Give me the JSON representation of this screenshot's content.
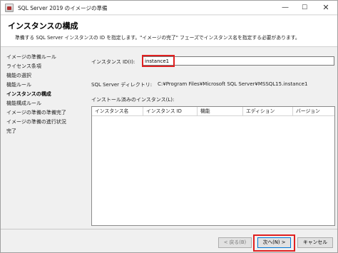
{
  "window": {
    "title": "SQL Server 2019 のイメージの準備",
    "minimize": "—",
    "maximize": "☐",
    "close": "✕"
  },
  "header": {
    "title": "インスタンスの構成",
    "description": "準備する SQL Server インスタンスの ID を指定します。\"イメージの完了\" フェーズでインスタンス名を指定する必要があります。"
  },
  "sidebar": {
    "items": [
      {
        "label": "イメージの準備ルール",
        "active": false
      },
      {
        "label": "ライセンス条項",
        "active": false
      },
      {
        "label": "機能の選択",
        "active": false
      },
      {
        "label": "機能ルール",
        "active": false
      },
      {
        "label": "インスタンスの構成",
        "active": true
      },
      {
        "label": "機能構成ルール",
        "active": false
      },
      {
        "label": "イメージの準備の準備完了",
        "active": false
      },
      {
        "label": "イメージの準備の進行状況",
        "active": false
      },
      {
        "label": "完了",
        "active": false
      }
    ]
  },
  "main": {
    "instance_id_label": "インスタンス ID(I):",
    "instance_id_value": "instance1",
    "directory_label": "SQL Server ディレクトリ:",
    "directory_value": "C:¥Program Files¥Microsoft SQL Server¥MSSQL15.instance1",
    "installed_label": "インストール済みのインスタンス(L):",
    "columns": [
      "インスタンス名",
      "インスタンス ID",
      "機能",
      "エディション",
      "バージョン"
    ]
  },
  "footer": {
    "back": "< 戻る(B)",
    "next": "次へ(N) >",
    "cancel": "キャンセル"
  },
  "colors": {
    "highlight": "#e02020",
    "window_bg": "#f0f0f0"
  }
}
